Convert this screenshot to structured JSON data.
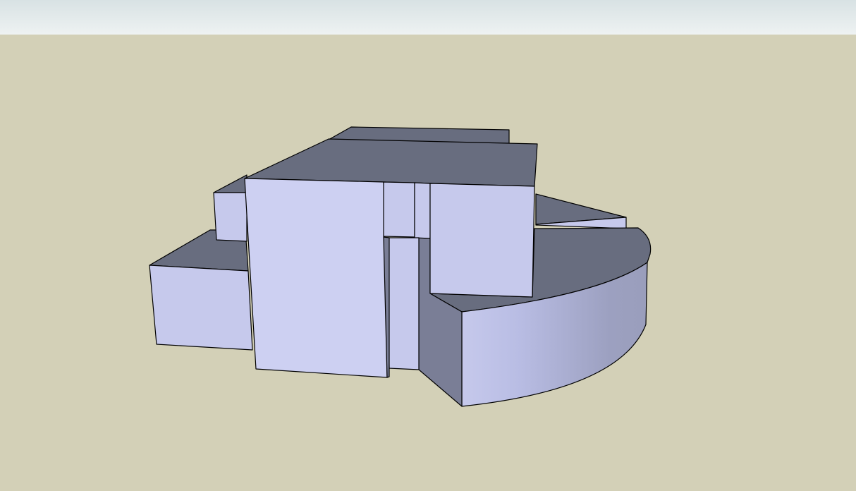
{
  "viewport": {
    "sky_gradient": [
      "#d8e2e4",
      "#eef2f2"
    ],
    "ground_color": "#d3d0b7"
  },
  "model": {
    "face_light": "#c6c9ec",
    "face_lighter": "#cdd0f2",
    "face_top": "#686d7f",
    "face_shadow": "#7a7e96",
    "curve_gradient": [
      "#c6c9ec",
      "#b9bde4",
      "#9ca0c0",
      "#9a9ebc"
    ]
  }
}
